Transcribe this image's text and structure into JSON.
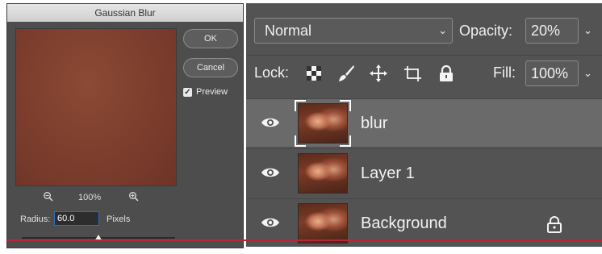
{
  "gaussian_blur": {
    "title": "Gaussian Blur",
    "ok_label": "OK",
    "cancel_label": "Cancel",
    "preview_label": "Preview",
    "preview_checked": true,
    "zoom_out_icon": "zoom-out-icon",
    "zoom_percent": "100%",
    "zoom_in_icon": "zoom-in-icon",
    "radius_label": "Radius:",
    "radius_value": "60.0",
    "radius_units": "Pixels",
    "radius_slider_fraction": 0.5
  },
  "layers_panel": {
    "blend_mode": "Normal",
    "opacity_label": "Opacity:",
    "opacity_value": "20%",
    "lock_label": "Lock:",
    "lock_icons": [
      "lock-transparent-pixels-icon",
      "lock-image-pixels-icon",
      "lock-position-icon",
      "lock-artboards-icon",
      "lock-all-icon"
    ],
    "fill_label": "Fill:",
    "fill_value": "100%",
    "layers": [
      {
        "name": "blur",
        "visible": true,
        "selected": true,
        "locked": false
      },
      {
        "name": "Layer 1",
        "visible": true,
        "selected": false,
        "locked": false
      },
      {
        "name": "Background",
        "visible": true,
        "selected": false,
        "locked": true
      }
    ]
  },
  "colors": {
    "dialog_bg": "#4d4d4d",
    "panel_bg": "#535353",
    "selected_row": "#6a6a6a",
    "preview_fill": "#7c3d2d",
    "accent_red": "#b4283a",
    "input_focus": "#2f6fb3"
  }
}
